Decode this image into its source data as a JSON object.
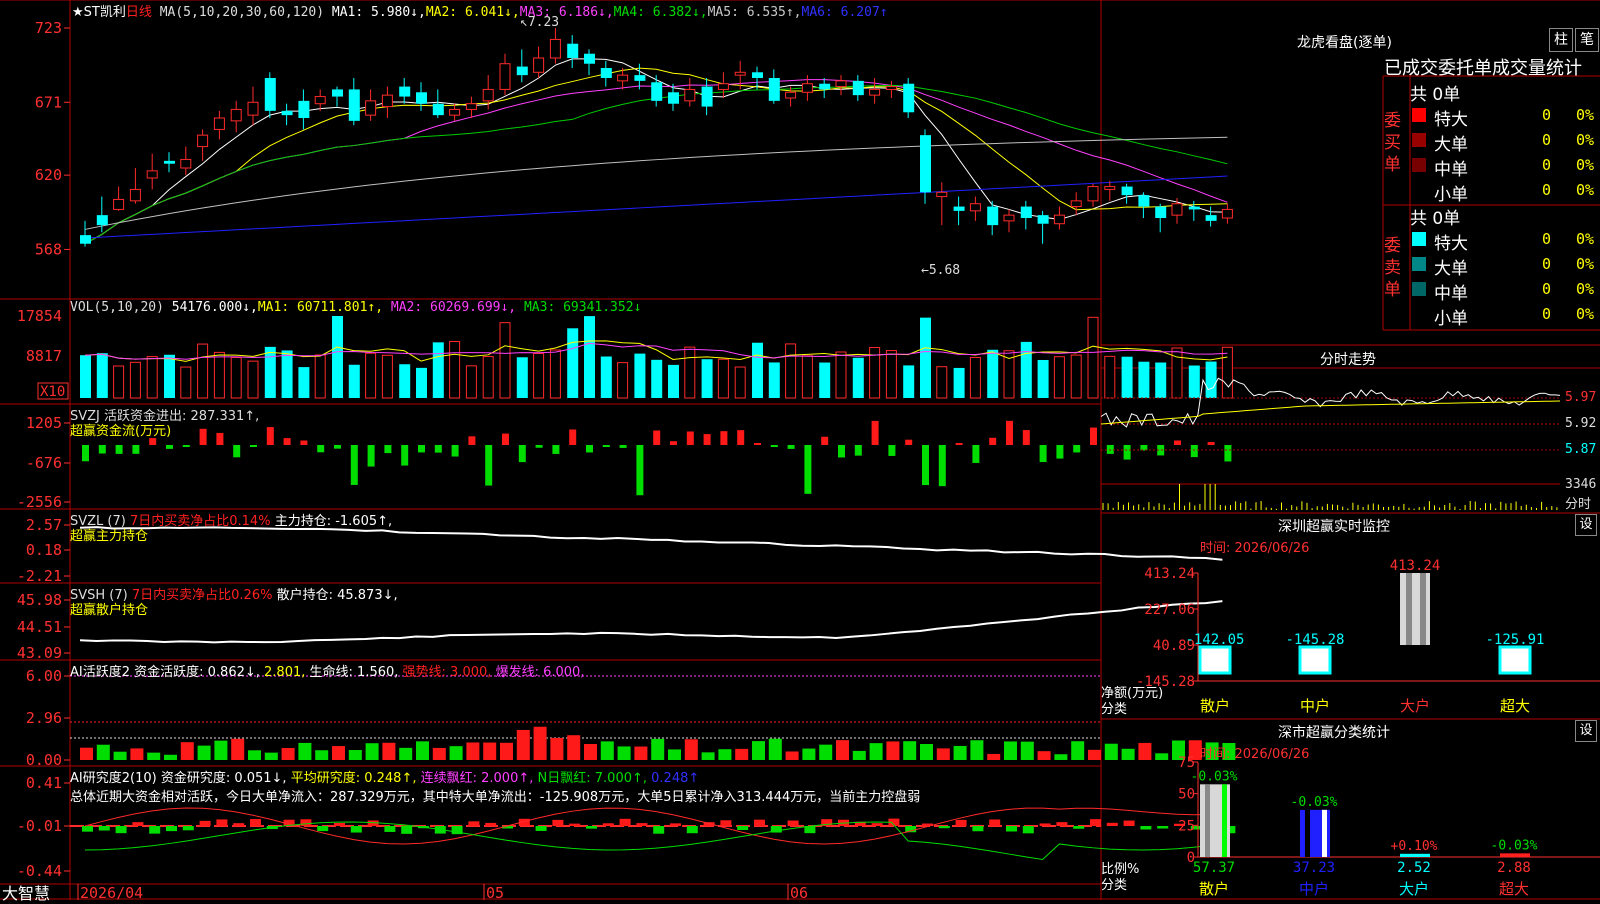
{
  "app": {
    "brand": "大智慧"
  },
  "colors": {
    "up": "#ff2a2a",
    "down": "#00ffff",
    "volDown": "#00ffff",
    "flowUp": "#ff1a1a",
    "flowDown": "#00dd00",
    "grid": "#b00000",
    "label": "#ff3030",
    "white": "#ffffff",
    "yellow": "#ffff00",
    "magenta": "#ff40ff",
    "green": "#00cc00",
    "gray": "#c0c0c0",
    "blue": "#2020ff"
  },
  "main": {
    "title": "★ST凯利",
    "period": "日线",
    "ma_params": "MA(5,10,20,30,60,120)",
    "ma_values": [
      "MA1: 5.980↓,",
      "MA2: 6.041↓,",
      "MA3: 6.186↓,",
      "MA4: 6.382↓,",
      "MA5: 6.535↑,",
      "MA6: 6.207↑"
    ],
    "y_ticks": [
      "723",
      "671",
      "620",
      "568"
    ],
    "y_values": [
      7.23,
      6.71,
      6.2,
      5.68
    ],
    "high_label": "7.23",
    "low_label": "5.68"
  },
  "vol": {
    "header": "VOL(5,10,20)",
    "value": "54176.000↓,",
    "ma": [
      "MA1: 60711.801↑,",
      "MA2: 60269.699↓,",
      "MA3: 69341.352↓"
    ],
    "y_ticks": [
      "17854",
      "8817"
    ],
    "unit_box": "X10"
  },
  "svzj": {
    "header": "SVZJ  活跃资金进出: 287.331↑,",
    "sub": "超赢资金流(万元)",
    "y_ticks": [
      "1205",
      "-676",
      "-2556"
    ]
  },
  "svzl": {
    "header_a": "SVZL (7)",
    "header_b": "7日内买卖净占比0.14%",
    "header_c": "主力持仓: -1.605↑,",
    "sub": "超赢主力持仓",
    "y_ticks": [
      "2.57",
      "0.18",
      "-2.21"
    ]
  },
  "svsh": {
    "header_a": "SVSH (7)",
    "header_b": "7日内买卖净占比0.26%",
    "header_c": "散户持仓: 45.873↓,",
    "sub": "超赢散户持仓",
    "y_ticks": [
      "45.98",
      "44.51",
      "43.09"
    ]
  },
  "ai1": {
    "header_a": "AI活跃度2 资金活跃度: 0.862↓,",
    "header_b": "2.801,",
    "header_c": "生命线: 1.560,",
    "header_d": "强势线: 3.000,",
    "header_e": "爆发线: 6.000,",
    "y_ticks": [
      "6.00",
      "2.96",
      "0.00"
    ]
  },
  "ai2": {
    "header_a": "AI研究度2(10) 资金研究度: 0.051↓,",
    "header_b": "平均研究度: 0.248↑,",
    "header_c": "连续飘红: 2.000↑,",
    "header_d": "N日飘红: 7.000↑,",
    "header_e": "0.248↑",
    "summary": "总体近期大资金相对活跃，今日大单净流入：287.329万元，其中特大单净流出：-125.908万元，大单5日累计净入313.444万元，当前主力控盘弱",
    "y_ticks": [
      "0.41",
      "-0.01",
      "-0.44"
    ]
  },
  "xaxis": {
    "labels": [
      "2026/04",
      "05",
      "06"
    ]
  },
  "lhb": {
    "title": "龙虎看盘(逐单)",
    "tab_bar": "柱",
    "tab_pen": "笔",
    "subtitle": "已成交委托单成交量统计",
    "buy_group": "委买单",
    "sell_group": "委卖单",
    "buy_count": "共 0单",
    "sell_count": "共 0单",
    "rows": [
      {
        "name": "特大",
        "vol": "0",
        "pct": "0%"
      },
      {
        "name": "大单",
        "vol": "0",
        "pct": "0%"
      },
      {
        "name": "中单",
        "vol": "0",
        "pct": "0%"
      },
      {
        "name": "小单",
        "vol": "0",
        "pct": "0%"
      }
    ]
  },
  "intraday": {
    "title": "分时走势",
    "y_ticks": [
      "5.97",
      "5.92",
      "5.87"
    ],
    "vol_tick": "3346",
    "vol_unit": "分时"
  },
  "sz_rt": {
    "title": "深圳超赢实时监控",
    "set": "设",
    "time": "时间: 2026/06/26",
    "y_ticks": [
      "413.24",
      "227.06",
      "40.89",
      "-145.28"
    ],
    "y_label_1": "净额(万元)",
    "y_label_2": "分类",
    "categories": [
      "散户",
      "中户",
      "大户",
      "超大"
    ],
    "value_labels": [
      "-142.05",
      "-145.28",
      "413.24",
      "-125.91"
    ]
  },
  "sz_cls": {
    "title": "深市超赢分类统计",
    "set": "设",
    "time": "时间: 2026/06/26",
    "y_ticks": [
      "75",
      "50",
      "25",
      "0"
    ],
    "y_label_1": "比例%",
    "y_label_2": "分类",
    "categories": [
      "散户",
      "中户",
      "大户",
      "超大"
    ],
    "top_labels": [
      "-0.03%",
      "-0.03%",
      "+0.10%",
      "-0.03%"
    ],
    "bottom_labels": [
      "57.37",
      "37.23",
      "2.52",
      "2.88"
    ]
  },
  "chart_data": {
    "type": "bar",
    "title": "深圳超赢实时监控",
    "categories": [
      "散户",
      "中户",
      "大户",
      "超大"
    ],
    "series": [
      {
        "values": [
          -142.05,
          -145.28,
          413.24,
          -125.91
        ]
      }
    ],
    "ylabel": "净额(万元)",
    "xlabel": "分类",
    "ylim": [
      -145.28,
      413.24
    ],
    "secondary": {
      "type": "bar",
      "title": "深市超赢分类统计",
      "categories": [
        "散户",
        "中户",
        "大户",
        "超大"
      ],
      "values": [
        57.37,
        37.23,
        2.52,
        2.88
      ],
      "change": [
        "-0.03%",
        "-0.03%",
        "+0.10%",
        "-0.03%"
      ],
      "ylabel": "比例%",
      "ylim": [
        0,
        75
      ]
    },
    "kline": {
      "type": "candlestick",
      "high": 7.23,
      "low": 5.68,
      "ylim": [
        5.68,
        7.23
      ],
      "ohlc": [
        [
          5.78,
          5.72,
          5.7,
          5.88
        ],
        [
          5.92,
          5.85,
          5.8,
          6.05
        ],
        [
          5.96,
          6.03,
          5.95,
          6.12
        ],
        [
          6.02,
          6.1,
          6.0,
          6.25
        ],
        [
          6.18,
          6.23,
          6.1,
          6.35
        ],
        [
          6.3,
          6.28,
          6.22,
          6.36
        ],
        [
          6.25,
          6.31,
          6.2,
          6.4
        ],
        [
          6.4,
          6.48,
          6.3,
          6.52
        ],
        [
          6.52,
          6.6,
          6.45,
          6.65
        ],
        [
          6.58,
          6.66,
          6.5,
          6.72
        ],
        [
          6.62,
          6.71,
          6.55,
          6.82
        ],
        [
          6.88,
          6.65,
          6.6,
          6.92
        ],
        [
          6.65,
          6.62,
          6.55,
          6.7
        ],
        [
          6.72,
          6.6,
          6.52,
          6.8
        ],
        [
          6.7,
          6.75,
          6.65,
          6.8
        ],
        [
          6.8,
          6.75,
          6.68,
          6.82
        ],
        [
          6.8,
          6.58,
          6.55,
          6.88
        ],
        [
          6.62,
          6.72,
          6.58,
          6.8
        ],
        [
          6.68,
          6.76,
          6.6,
          6.82
        ],
        [
          6.82,
          6.75,
          6.7,
          6.88
        ],
        [
          6.78,
          6.7,
          6.65,
          6.85
        ],
        [
          6.7,
          6.62,
          6.6,
          6.8
        ],
        [
          6.62,
          6.66,
          6.58,
          6.7
        ],
        [
          6.66,
          6.7,
          6.6,
          6.75
        ],
        [
          6.72,
          6.8,
          6.66,
          6.9
        ],
        [
          6.8,
          6.98,
          6.76,
          7.05
        ],
        [
          6.96,
          6.9,
          6.85,
          7.08
        ],
        [
          6.92,
          7.02,
          6.88,
          7.1
        ],
        [
          7.02,
          7.15,
          6.98,
          7.23
        ],
        [
          7.12,
          7.02,
          6.95,
          7.18
        ],
        [
          7.05,
          6.98,
          6.9,
          7.08
        ],
        [
          6.95,
          6.88,
          6.82,
          7.0
        ],
        [
          6.86,
          6.9,
          6.8,
          6.95
        ],
        [
          6.9,
          6.86,
          6.8,
          6.98
        ],
        [
          6.85,
          6.72,
          6.68,
          6.9
        ],
        [
          6.78,
          6.7,
          6.65,
          6.84
        ],
        [
          6.72,
          6.8,
          6.68,
          6.88
        ],
        [
          6.82,
          6.68,
          6.62,
          6.88
        ],
        [
          6.8,
          6.84,
          6.74,
          6.92
        ],
        [
          6.9,
          6.92,
          6.8,
          7.0
        ],
        [
          6.92,
          6.88,
          6.8,
          6.96
        ],
        [
          6.88,
          6.72,
          6.7,
          6.94
        ],
        [
          6.74,
          6.78,
          6.68,
          6.82
        ],
        [
          6.78,
          6.84,
          6.72,
          6.9
        ],
        [
          6.84,
          6.8,
          6.74,
          6.88
        ],
        [
          6.82,
          6.86,
          6.76,
          6.9
        ],
        [
          6.86,
          6.76,
          6.72,
          6.9
        ],
        [
          6.76,
          6.8,
          6.7,
          6.88
        ],
        [
          6.8,
          6.82,
          6.74,
          6.86
        ],
        [
          6.84,
          6.64,
          6.6,
          6.88
        ],
        [
          6.48,
          6.08,
          6.0,
          6.52
        ],
        [
          6.05,
          6.08,
          5.85,
          6.15
        ],
        [
          5.98,
          5.95,
          5.85,
          6.05
        ],
        [
          5.95,
          6.0,
          5.88,
          6.05
        ],
        [
          5.98,
          5.85,
          5.78,
          6.02
        ],
        [
          5.88,
          5.92,
          5.8,
          5.96
        ],
        [
          5.98,
          5.9,
          5.82,
          6.02
        ],
        [
          5.92,
          5.86,
          5.72,
          5.95
        ],
        [
          5.86,
          5.92,
          5.82,
          5.98
        ],
        [
          5.98,
          6.02,
          5.92,
          6.08
        ],
        [
          6.02,
          6.12,
          5.98,
          6.14
        ],
        [
          6.1,
          6.12,
          6.02,
          6.16
        ],
        [
          6.12,
          6.06,
          6.0,
          6.14
        ],
        [
          6.06,
          5.98,
          5.9,
          6.08
        ],
        [
          5.98,
          5.9,
          5.8,
          6.0
        ],
        [
          5.92,
          6.0,
          5.86,
          6.04
        ],
        [
          5.98,
          5.96,
          5.88,
          6.02
        ],
        [
          5.92,
          5.88,
          5.84,
          5.98
        ],
        [
          5.9,
          5.96,
          5.86,
          6.0
        ]
      ]
    }
  }
}
